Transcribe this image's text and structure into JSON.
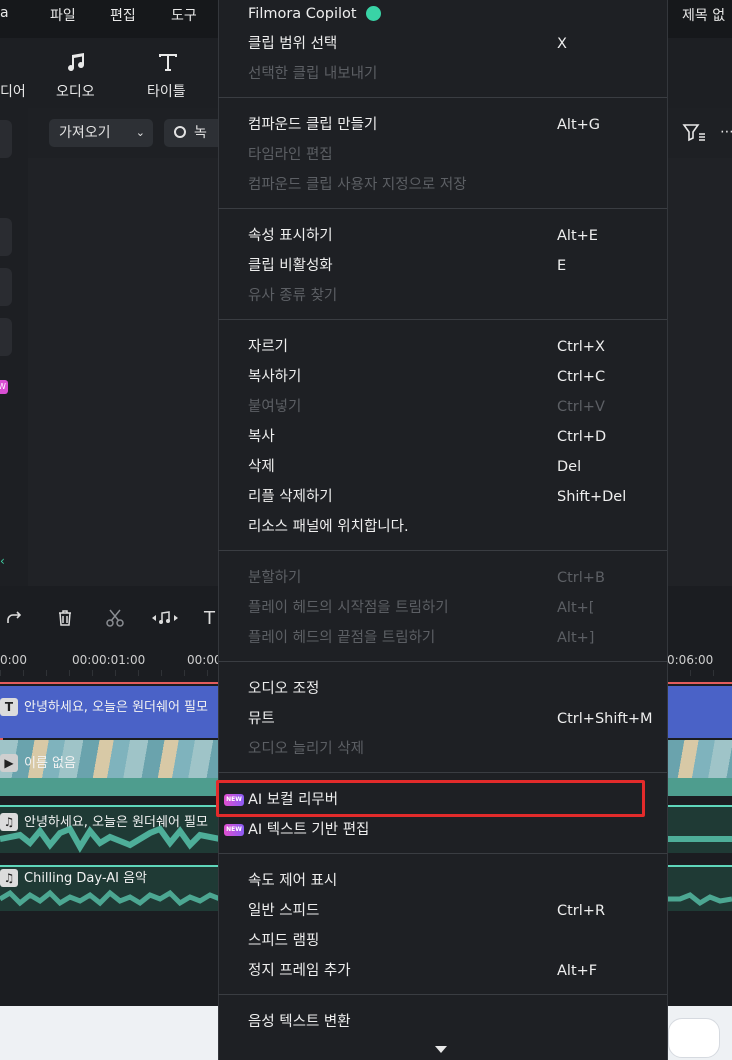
{
  "menubar": {
    "left_fragment": "a",
    "items": [
      "파일",
      "편집",
      "도구"
    ],
    "right_fragment": "제목 없"
  },
  "toolbar": {
    "left_fragment": "디어",
    "audio_label": "오디오",
    "title_label": "타이틀"
  },
  "media": {
    "import_label": "가져오기",
    "record_fragment": "녹",
    "new_badge": "W"
  },
  "timeline": {
    "ruler": [
      "0:00",
      "00:00:01:00",
      "00:00",
      "0:06:00"
    ],
    "tracks": {
      "title_clip": "안녕하세요, 오늘은 원더쉐어 필모",
      "video_clip": "이름 없음",
      "voice_clip": "안녕하세요, 오늘은 원더쉐어 필모",
      "music_clip": "Chilling Day-AI 음악"
    }
  },
  "context_menu": {
    "groups": [
      {
        "items": [
          {
            "label": "Filmora Copilot",
            "shortcut": "",
            "enabled": true,
            "icon": "copilot-icon"
          },
          {
            "label": "클립 범위 선택",
            "shortcut": "X",
            "enabled": true
          },
          {
            "label": "선택한 클립 내보내기",
            "shortcut": "",
            "enabled": false
          }
        ]
      },
      {
        "items": [
          {
            "label": "컴파운드 클립 만들기",
            "shortcut": "Alt+G",
            "enabled": true
          },
          {
            "label": "타임라인 편집",
            "shortcut": "",
            "enabled": false
          },
          {
            "label": "컴파운드 클립 사용자 지정으로 저장",
            "shortcut": "",
            "enabled": false
          }
        ]
      },
      {
        "items": [
          {
            "label": "속성 표시하기",
            "shortcut": "Alt+E",
            "enabled": true
          },
          {
            "label": "클립 비활성화",
            "shortcut": "E",
            "enabled": true
          },
          {
            "label": "유사 종류 찾기",
            "shortcut": "",
            "enabled": false
          }
        ]
      },
      {
        "items": [
          {
            "label": "자르기",
            "shortcut": "Ctrl+X",
            "enabled": true
          },
          {
            "label": "복사하기",
            "shortcut": "Ctrl+C",
            "enabled": true
          },
          {
            "label": "붙여넣기",
            "shortcut": "Ctrl+V",
            "enabled": false
          },
          {
            "label": "복사",
            "shortcut": "Ctrl+D",
            "enabled": true
          },
          {
            "label": "삭제",
            "shortcut": "Del",
            "enabled": true
          },
          {
            "label": "리플 삭제하기",
            "shortcut": "Shift+Del",
            "enabled": true
          },
          {
            "label": "리소스 패널에 위치합니다.",
            "shortcut": "",
            "enabled": true
          }
        ]
      },
      {
        "items": [
          {
            "label": "분할하기",
            "shortcut": "Ctrl+B",
            "enabled": false
          },
          {
            "label": "플레이 헤드의 시작점을 트림하기",
            "shortcut": "Alt+[",
            "enabled": false
          },
          {
            "label": "플레이 헤드의 끝점을 트림하기",
            "shortcut": "Alt+]",
            "enabled": false
          }
        ]
      },
      {
        "items": [
          {
            "label": "오디오 조정",
            "shortcut": "",
            "enabled": true
          },
          {
            "label": "뮤트",
            "shortcut": "Ctrl+Shift+M",
            "enabled": true
          },
          {
            "label": "오디오 늘리기 삭제",
            "shortcut": "",
            "enabled": false
          }
        ]
      },
      {
        "items": [
          {
            "label": "AI 보컬 리무버",
            "shortcut": "",
            "enabled": true,
            "badge": "NEW",
            "highlighted": true
          },
          {
            "label": "AI 텍스트 기반 편집",
            "shortcut": "",
            "enabled": true,
            "badge": "NEW"
          }
        ]
      },
      {
        "items": [
          {
            "label": "속도 제어 표시",
            "shortcut": "",
            "enabled": true
          },
          {
            "label": "일반 스피드",
            "shortcut": "Ctrl+R",
            "enabled": true
          },
          {
            "label": "스피드 램핑",
            "shortcut": "",
            "enabled": true
          },
          {
            "label": "정지 프레임 추가",
            "shortcut": "Alt+F",
            "enabled": true
          }
        ]
      },
      {
        "items": [
          {
            "label": "음성 텍스트 변환",
            "shortcut": "",
            "enabled": true
          }
        ]
      }
    ],
    "scroll_indicator": "scroll-down-arrow-icon",
    "highlight_color": "#e32b2b"
  }
}
